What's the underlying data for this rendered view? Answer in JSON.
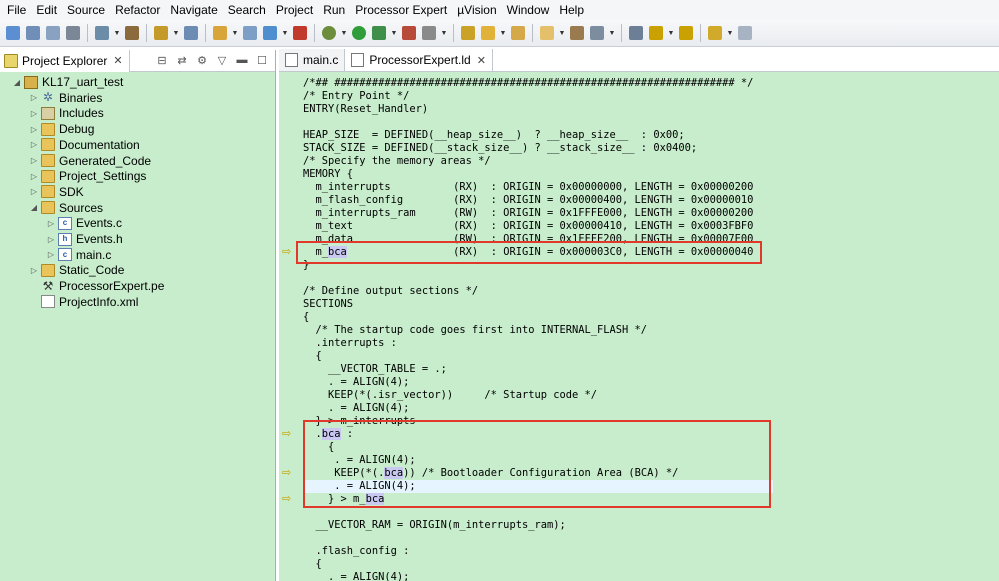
{
  "menu": [
    "File",
    "Edit",
    "Source",
    "Refactor",
    "Navigate",
    "Search",
    "Project",
    "Run",
    "Processor Expert",
    "µVision",
    "Window",
    "Help"
  ],
  "toolbar": {
    "icons": [
      "new-icon",
      "save-icon",
      "save-all-icon",
      "print-icon",
      "build-settings-icon",
      "hammer-icon",
      "load-icon",
      "image-icon",
      "new-project-icon",
      "properties-icon",
      "refresh-icon",
      "processor-expert-icon",
      "bug-icon",
      "run-icon",
      "run-history-icon",
      "external-tools-icon",
      "skip-breakpoints-icon",
      "hand-icon",
      "lightning-icon",
      "open-folder-icon",
      "folder-icon",
      "pen-icon",
      "toggle-view-icon",
      "paragraph-icon",
      "next-annotation-icon",
      "prev-annotation-icon",
      "back-arrow-icon",
      "forward-arrow-icon"
    ],
    "colors": {
      "accent": "#2b7cd3",
      "run": "#2f9e3a",
      "debug": "#6c8d3b"
    }
  },
  "left_panel": {
    "tab_label": "Project Explorer",
    "tree": [
      {
        "label": "KL17_uart_test",
        "icon": "project",
        "depth": 0,
        "expanded": true
      },
      {
        "label": "Binaries",
        "icon": "gear",
        "depth": 1,
        "expanded": false
      },
      {
        "label": "Includes",
        "icon": "includes",
        "depth": 1,
        "expanded": false
      },
      {
        "label": "Debug",
        "icon": "folder",
        "depth": 1,
        "expanded": false
      },
      {
        "label": "Documentation",
        "icon": "folder",
        "depth": 1,
        "expanded": false
      },
      {
        "label": "Generated_Code",
        "icon": "folder",
        "depth": 1,
        "expanded": false
      },
      {
        "label": "Project_Settings",
        "icon": "folder",
        "depth": 1,
        "expanded": false
      },
      {
        "label": "SDK",
        "icon": "folder",
        "depth": 1,
        "expanded": false
      },
      {
        "label": "Sources",
        "icon": "folder",
        "depth": 1,
        "expanded": true
      },
      {
        "label": "Events.c",
        "icon": "c",
        "depth": 2,
        "expanded": false
      },
      {
        "label": "Events.h",
        "icon": "h",
        "depth": 2,
        "expanded": false
      },
      {
        "label": "main.c",
        "icon": "c",
        "depth": 2,
        "expanded": false
      },
      {
        "label": "Static_Code",
        "icon": "folder",
        "depth": 1,
        "expanded": false
      },
      {
        "label": "ProcessorExpert.pe",
        "icon": "pe",
        "depth": 1,
        "expanded": null
      },
      {
        "label": "ProjectInfo.xml",
        "icon": "xml",
        "depth": 1,
        "expanded": null
      }
    ]
  },
  "editor": {
    "tabs": [
      {
        "label": "main.c",
        "active": false
      },
      {
        "label": "ProcessorExpert.ld",
        "active": true
      }
    ],
    "highlight_color": "#c9c8f0",
    "lines": [
      "/*## ################################################################ */",
      "/* Entry Point */",
      "ENTRY(Reset_Handler)",
      "",
      "HEAP_SIZE  = DEFINED(__heap_size__)  ? __heap_size__  : 0x00;",
      "STACK_SIZE = DEFINED(__stack_size__) ? __stack_size__ : 0x0400;",
      "/* Specify the memory areas */",
      "MEMORY {",
      "  m_interrupts          (RX)  : ORIGIN = 0x00000000, LENGTH = 0x00000200",
      "  m_flash_config        (RX)  : ORIGIN = 0x00000400, LENGTH = 0x00000010",
      "  m_interrupts_ram      (RW)  : ORIGIN = 0x1FFFE000, LENGTH = 0x00000200",
      "  m_text                (RX)  : ORIGIN = 0x00000410, LENGTH = 0x0003FBF0",
      "  m_data                (RW)  : ORIGIN = 0x1FFFE200, LENGTH = 0x00007E00",
      "  m_bca                 (RX)  : ORIGIN = 0x000003C0, LENGTH = 0x00000040",
      "}",
      "",
      "/* Define output sections */",
      "SECTIONS",
      "{",
      "  /* The startup code goes first into INTERNAL_FLASH */",
      "  .interrupts :",
      "  {",
      "    __VECTOR_TABLE = .;",
      "    . = ALIGN(4);",
      "    KEEP(*(.isr_vector))     /* Startup code */",
      "    . = ALIGN(4);",
      "  } > m_interrupts",
      "  .bca :",
      "    {",
      "     . = ALIGN(4);",
      "     KEEP(*(.bca)) /* Bootloader Configuration Area (BCA) */",
      "     . = ALIGN(4);",
      "    } > m_bca",
      "",
      "  __VECTOR_RAM = ORIGIN(m_interrupts_ram);",
      "",
      "  .flash_config :",
      "  {",
      "    . = ALIGN(4);"
    ]
  }
}
